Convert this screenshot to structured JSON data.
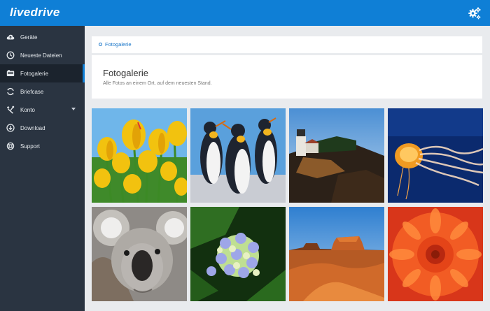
{
  "app": {
    "logo": "livedrive"
  },
  "sidebar": {
    "items": [
      {
        "label": "Geräte",
        "icon": "cloud-icon"
      },
      {
        "label": "Neueste Dateien",
        "icon": "clock-icon"
      },
      {
        "label": "Fotogalerie",
        "icon": "photo-icon"
      },
      {
        "label": "Briefcase",
        "icon": "sync-icon"
      },
      {
        "label": "Konto",
        "icon": "tools-icon"
      },
      {
        "label": "Download",
        "icon": "download-icon"
      },
      {
        "label": "Support",
        "icon": "lifebuoy-icon"
      }
    ]
  },
  "breadcrumb": {
    "label": "Fotogalerie"
  },
  "header": {
    "title": "Fotogalerie",
    "subtitle": "Alle Fotos an einem Ort, auf dem neuesten Stand."
  },
  "gallery": {
    "photos": [
      "tulips",
      "penguins",
      "lighthouse",
      "jellyfish",
      "koala",
      "hydrangea",
      "desert",
      "chrysanthemum"
    ]
  },
  "colors": {
    "accent": "#0f7fd6",
    "sidebar": "#2a3441",
    "sidebar_active": "#1b232d",
    "background": "#e9ebee"
  }
}
